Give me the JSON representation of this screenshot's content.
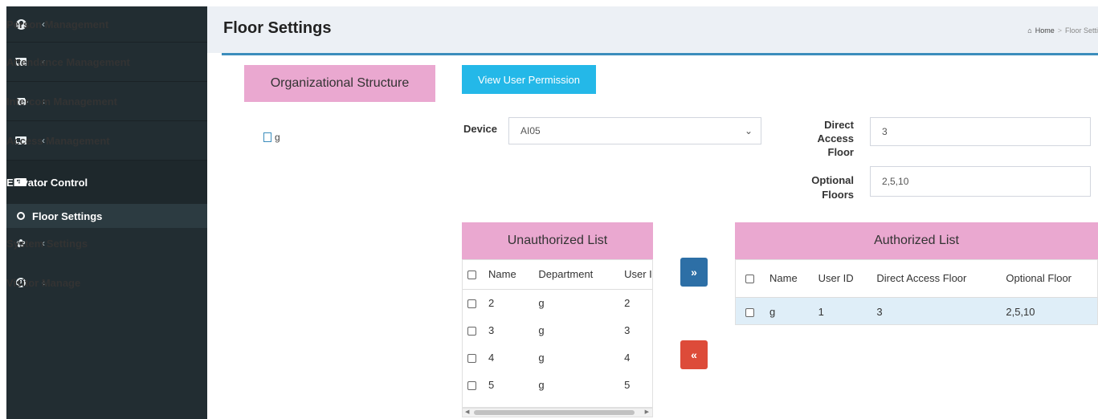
{
  "sidebar": {
    "items": [
      {
        "label": "Person Management",
        "icon": "person-circle-icon",
        "chevron": "‹"
      },
      {
        "label": "Attendance Management",
        "icon": "id-card-icon",
        "chevron": "‹"
      },
      {
        "label": "Intercom Management",
        "icon": "video-camera-icon",
        "chevron": "‹"
      },
      {
        "label": "Access Management",
        "icon": "id-card-icon",
        "chevron": "‹"
      },
      {
        "label": "Elevator Control",
        "icon": "id-card-icon",
        "chevron": "⌄"
      },
      {
        "label": "System Settings",
        "icon": "gear-icon",
        "chevron": "‹"
      },
      {
        "label": "Visitor Manage",
        "icon": "clock-icon",
        "chevron": "‹"
      }
    ],
    "active_sub": "Floor Settings"
  },
  "header": {
    "title": "Floor Settings",
    "breadcrumb_home": "Home",
    "breadcrumb_current": "Floor Setti"
  },
  "org": {
    "title": "Organizational Structure",
    "node": "g"
  },
  "form": {
    "view_button": "View User Permission",
    "device_label": "Device",
    "device_value": "AI05",
    "direct_label_1": "Direct",
    "direct_label_2": "Access",
    "direct_label_3": "Floor",
    "direct_value": "3",
    "optional_label_1": "Optional",
    "optional_label_2": "Floors",
    "optional_value": "2,5,10"
  },
  "unauthorized": {
    "title": "Unauthorized List",
    "columns": [
      "Name",
      "Department",
      "User ID"
    ],
    "rows": [
      {
        "name": "2",
        "dept": "g",
        "uid": "2"
      },
      {
        "name": "3",
        "dept": "g",
        "uid": "3"
      },
      {
        "name": "4",
        "dept": "g",
        "uid": "4"
      },
      {
        "name": "5",
        "dept": "g",
        "uid": "5"
      }
    ]
  },
  "move": {
    "right": "»",
    "left": "«"
  },
  "authorized": {
    "title": "Authorized List",
    "columns": [
      "Name",
      "User ID",
      "Direct Access Floor",
      "Optional Floor"
    ],
    "rows": [
      {
        "name": "g",
        "uid": "1",
        "direct": "3",
        "optional": "2,5,10"
      }
    ]
  },
  "colors": {
    "sidebar_bg": "#222d32",
    "accent_blue": "#3c8dbc",
    "header_pink": "#eaa8d0",
    "btn_cyan": "#24b8e8",
    "btn_red": "#dd4b39"
  }
}
